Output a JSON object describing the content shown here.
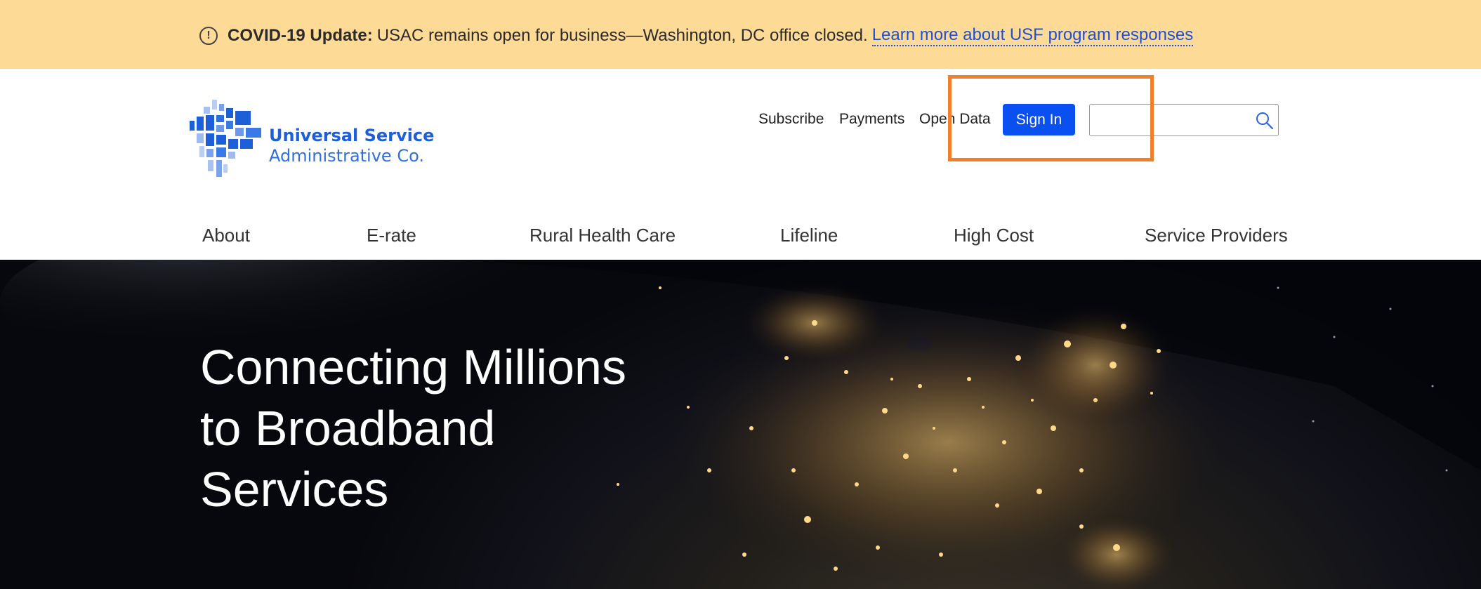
{
  "alert": {
    "icon": "info-circle-icon",
    "label": "COVID-19 Update:",
    "message": "USAC remains open for business—Washington, DC office closed.",
    "link_text": "Learn more about USF program responses"
  },
  "logo": {
    "line1": "Universal Service",
    "line2": "Administrative Co."
  },
  "utility_nav": {
    "subscribe": "Subscribe",
    "payments": "Payments",
    "open_data": "Open Data",
    "sign_in": "Sign In"
  },
  "search": {
    "value": "",
    "placeholder": ""
  },
  "main_nav": {
    "items": [
      "About",
      "E-rate",
      "Rural Health Care",
      "Lifeline",
      "High Cost",
      "Service Providers"
    ]
  },
  "hero": {
    "line1": "Connecting Millions",
    "line2": "to Broadband",
    "line3": "Services"
  },
  "colors": {
    "alert_bg": "#fdda96",
    "brand_blue": "#0a4ff0",
    "highlight_orange": "#f07f2a"
  }
}
